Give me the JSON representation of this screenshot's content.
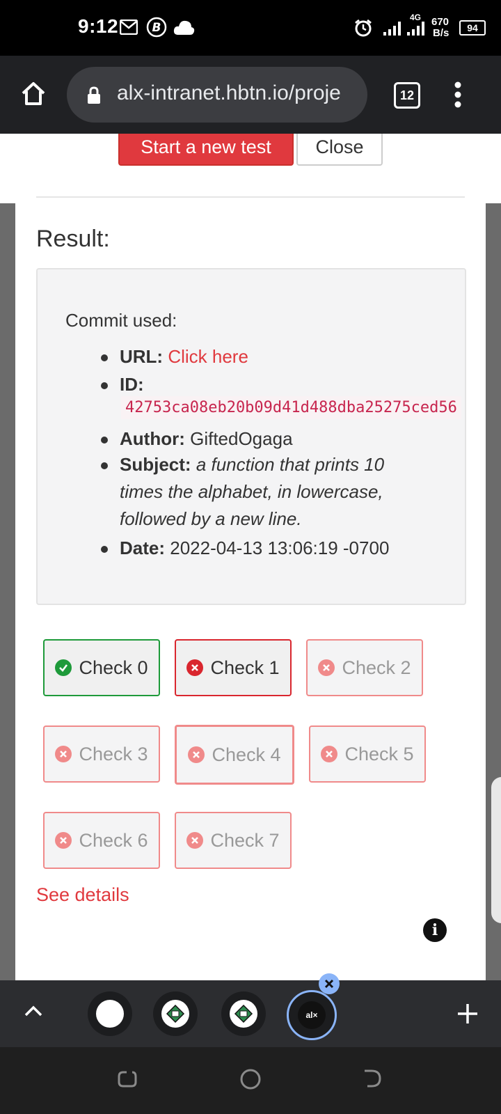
{
  "status_bar": {
    "time": "9:12",
    "network_speed_value": "670",
    "network_speed_unit": "B/s",
    "network_type": "4G",
    "battery": "94",
    "icons": [
      "gmail-icon",
      "b-icon",
      "cloud-icon",
      "alarm-icon",
      "signal-icon",
      "signal-icon",
      "battery-icon"
    ]
  },
  "browser": {
    "url": "alx-intranet.hbtn.io/proje",
    "tab_count": "12",
    "icons": [
      "home-icon",
      "lock-icon",
      "tab-switcher-icon",
      "more-vert-icon"
    ]
  },
  "actions": {
    "start_test": "Start a new test",
    "close": "Close"
  },
  "result": {
    "title": "Result:",
    "commit_label": "Commit used:",
    "url_label": "URL:",
    "url_link": "Click here",
    "id_label": "ID:",
    "id_value": "42753ca08eb20b09d41d488dba25275ced56",
    "author_label": "Author:",
    "author_value": "GiftedOgaga",
    "subject_label": "Subject:",
    "subject_line1": "a function that prints 10",
    "subject_line2": "times the alphabet, in lowercase,",
    "subject_line3": "followed by a new line.",
    "date_label": "Date:",
    "date_value": "2022-04-13 13:06:19 -0700"
  },
  "checks": [
    {
      "label": "Check 0",
      "status": "pass"
    },
    {
      "label": "Check 1",
      "status": "fail"
    },
    {
      "label": "Check 2",
      "status": "fail"
    },
    {
      "label": "Check 3",
      "status": "fail"
    },
    {
      "label": "Check 4",
      "status": "fail"
    },
    {
      "label": "Check 5",
      "status": "fail"
    },
    {
      "label": "Check 6",
      "status": "fail"
    },
    {
      "label": "Check 7",
      "status": "fail"
    }
  ],
  "see_details": "See details",
  "tab_strip": {
    "active_tab_text": "al×"
  },
  "colors": {
    "accent_red": "#e0393e",
    "pass_green": "#1e9a3a",
    "fail_red": "#d9262e"
  }
}
